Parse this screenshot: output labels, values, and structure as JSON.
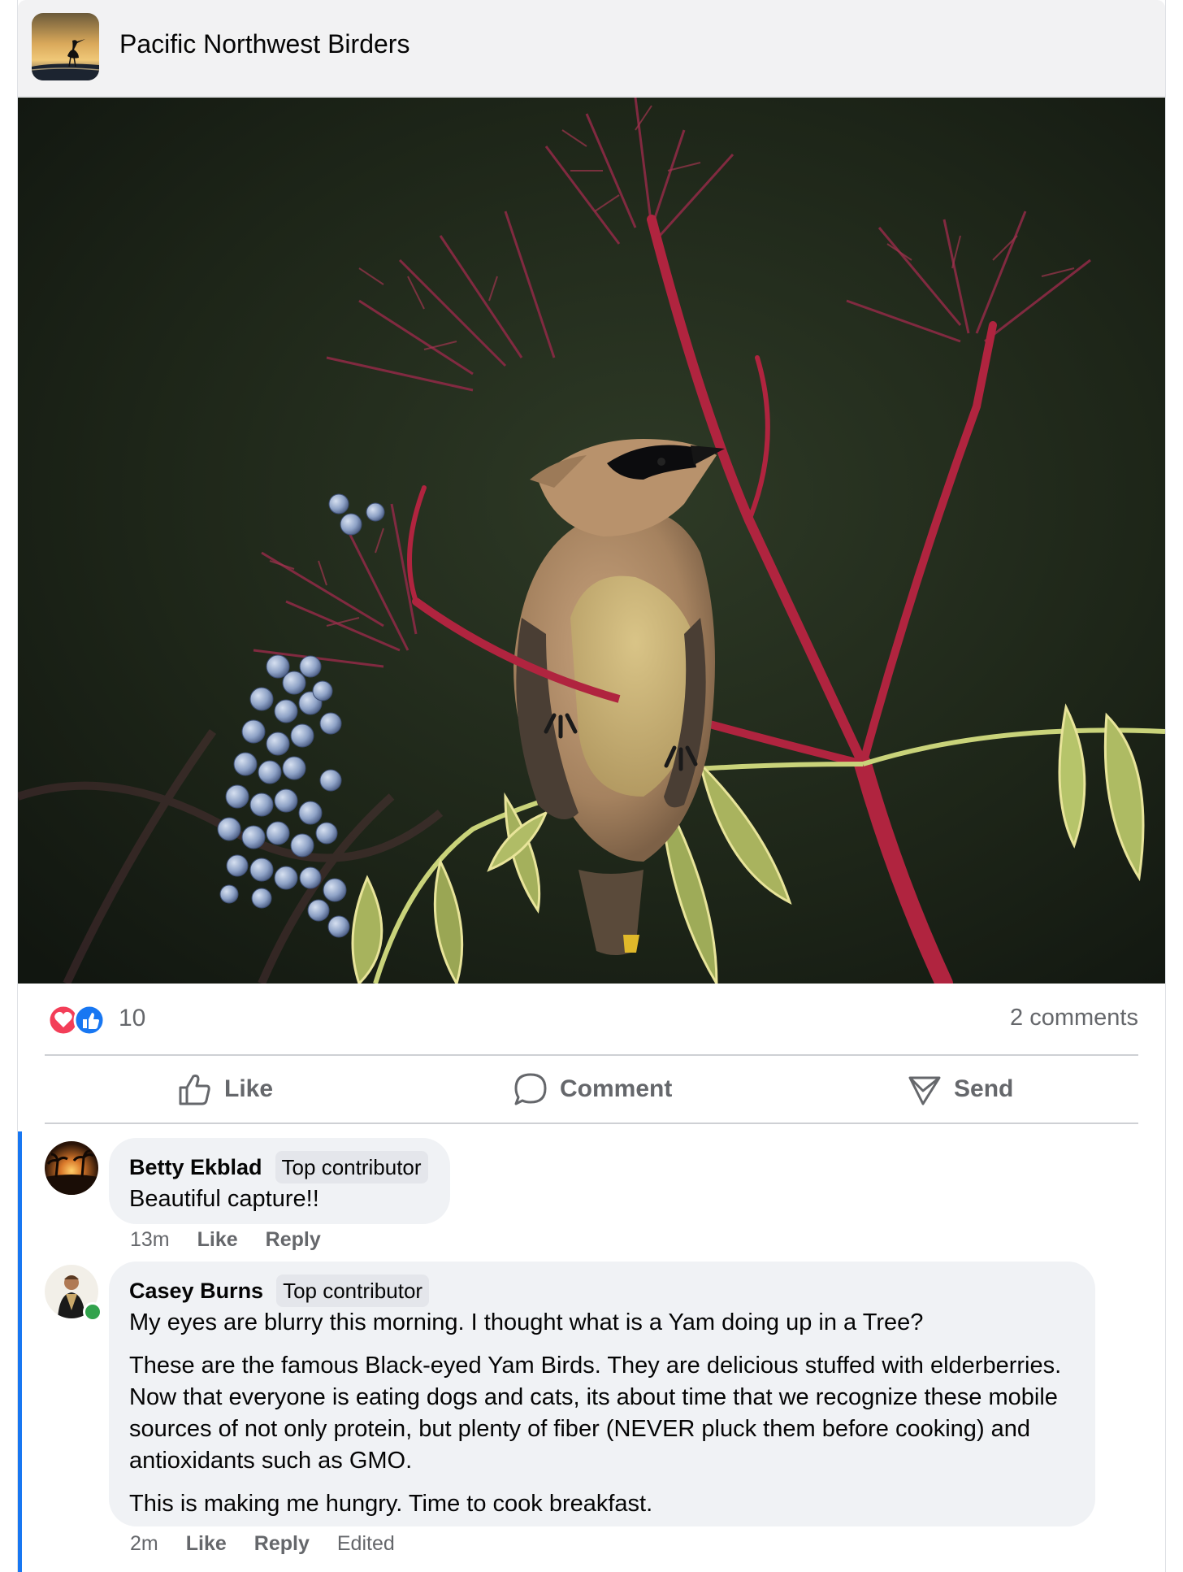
{
  "group": {
    "name": "Pacific Northwest Birders"
  },
  "post": {
    "reaction_count": "10",
    "comment_count_label": "2 comments",
    "reactions": [
      "love",
      "like"
    ]
  },
  "actions": {
    "like": "Like",
    "comment": "Comment",
    "send": "Send"
  },
  "comments": [
    {
      "author": "Betty Ekblad",
      "badge": "Top contributor",
      "paragraphs": [
        "Beautiful capture!!"
      ],
      "time": "13m",
      "like": "Like",
      "reply": "Reply"
    },
    {
      "author": "Casey Burns",
      "badge": "Top contributor",
      "paragraphs": [
        "My eyes are blurry this morning. I thought what is a Yam doing up in a Tree?",
        "These are the famous Black-eyed Yam Birds. They are delicious stuffed with elderberries. Now that everyone is eating dogs and cats, its about time that we recognize these mobile sources of not only protein, but plenty of fiber (NEVER pluck them before cooking) and antioxidants such as GMO.",
        "This is making me hungry. Time to cook breakfast."
      ],
      "time": "2m",
      "like": "Like",
      "reply": "Reply",
      "edited": "Edited"
    }
  ],
  "colors": {
    "accent": "#1877f2",
    "muted": "#65676b",
    "bubble": "#f0f2f5",
    "online": "#31a24c"
  },
  "icons": [
    "heron-silhouette-icon",
    "love-reaction-icon",
    "like-reaction-icon",
    "thumbs-up-icon",
    "speech-bubble-icon",
    "send-icon"
  ]
}
